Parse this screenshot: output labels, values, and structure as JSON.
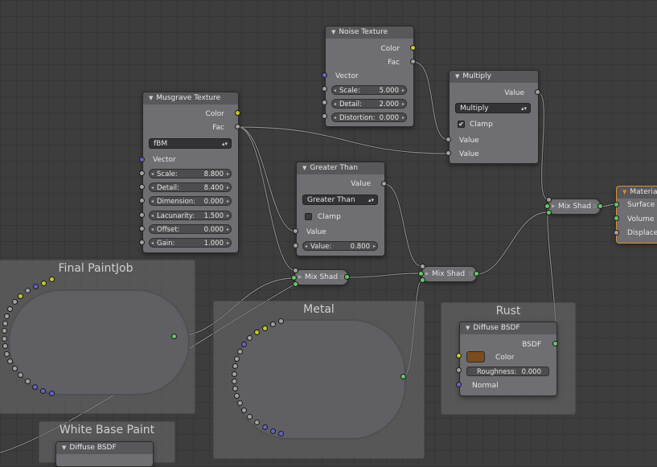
{
  "frames": {
    "final_paintjob": "Final PaintJob",
    "metal": "Metal",
    "rust": "Rust",
    "white_base_paint": "White Base Paint"
  },
  "noise_texture": {
    "title": "Noise Texture",
    "out_color": "Color",
    "out_fac": "Fac",
    "in_vector": "Vector",
    "scale_label": "Scale:",
    "scale_value": "5.000",
    "detail_label": "Detail:",
    "detail_value": "2.000",
    "distortion_label": "Distortion:",
    "distortion_value": "0.000"
  },
  "multiply": {
    "title": "Multiply",
    "out_value": "Value",
    "operation": "Multiply",
    "clamp_label": "Clamp",
    "clamp_checked": "✔",
    "in_value_1": "Value",
    "in_value_2": "Value"
  },
  "musgrave_texture": {
    "title": "Musgrave Texture",
    "out_color": "Color",
    "out_fac": "Fac",
    "type": "fBM",
    "in_vector": "Vector",
    "scale_label": "Scale:",
    "scale_value": "8.800",
    "detail_label": "Detail:",
    "detail_value": "8.400",
    "dimension_label": "Dimension:",
    "dimension_value": "0.000",
    "lacunarity_label": "Lacunarity:",
    "lacunarity_value": "1.500",
    "offset_label": "Offset:",
    "offset_value": "0.000",
    "gain_label": "Gain:",
    "gain_value": "1.000"
  },
  "greater_than": {
    "title": "Greater Than",
    "out_value": "Value",
    "operation": "Greater Than",
    "clamp_label": "Clamp",
    "in_value": "Value",
    "value_label": "Value:",
    "value_value": "0.800"
  },
  "material_output": {
    "title": "Material",
    "surface": "Surface",
    "volume": "Volume",
    "displacement": "Displacer"
  },
  "mix_shader_1": {
    "label": "Mix Shad"
  },
  "mix_shader_2": {
    "label": "Mix Shad"
  },
  "mix_shader_3": {
    "label": "Mix Shad"
  },
  "diffuse_bsdf_rust": {
    "title": "Diffuse BSDF",
    "out_bsdf": "BSDF",
    "color_label": "Color",
    "color_value": "#7a4c1e",
    "roughness_label": "Roughness:",
    "roughness_value": "0.000",
    "normal_label": "Normal"
  },
  "diffuse_bsdf_white": {
    "title": "Diffuse BSDF"
  },
  "icons": {
    "collapse": "triangle-down-icon",
    "grip": "grip-icon"
  },
  "colors": {
    "socket_color": "#c7c729",
    "socket_float": "#a1a1a1",
    "socket_vector": "#6363c7",
    "socket_shader": "#63c763",
    "output_border": "#d99035"
  }
}
